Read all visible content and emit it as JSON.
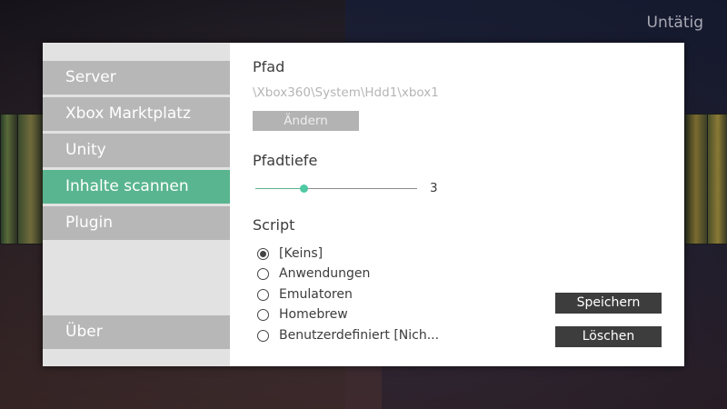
{
  "status": "Untätig",
  "sidebar": {
    "items": [
      {
        "label": "Server",
        "active": false
      },
      {
        "label": "Xbox Marktplatz",
        "active": false
      },
      {
        "label": "Unity",
        "active": false
      },
      {
        "label": "Inhalte scannen",
        "active": true
      },
      {
        "label": "Plugin",
        "active": false
      }
    ],
    "bottom_item": {
      "label": "Über"
    }
  },
  "content": {
    "path_heading": "Pfad",
    "path_value": "\\Xbox360\\System\\Hdd1\\xbox1",
    "change_button": "Ändern",
    "depth_heading": "Pfadtiefe",
    "depth_value": "3",
    "depth_fraction": 0.3,
    "script_heading": "Script",
    "script_options": [
      {
        "label": "[Keins]",
        "selected": true
      },
      {
        "label": "Anwendungen",
        "selected": false
      },
      {
        "label": "Emulatoren",
        "selected": false
      },
      {
        "label": "Homebrew",
        "selected": false
      },
      {
        "label": "Benutzerdefiniert [Nich...",
        "selected": false
      }
    ],
    "save_button": "Speichern",
    "delete_button": "Löschen"
  },
  "colors": {
    "accent": "#59b58f",
    "sidebar_item": "#b7b7b7",
    "sidebar_bg": "#e2e2e2",
    "button_dark": "#3d3d3d"
  }
}
